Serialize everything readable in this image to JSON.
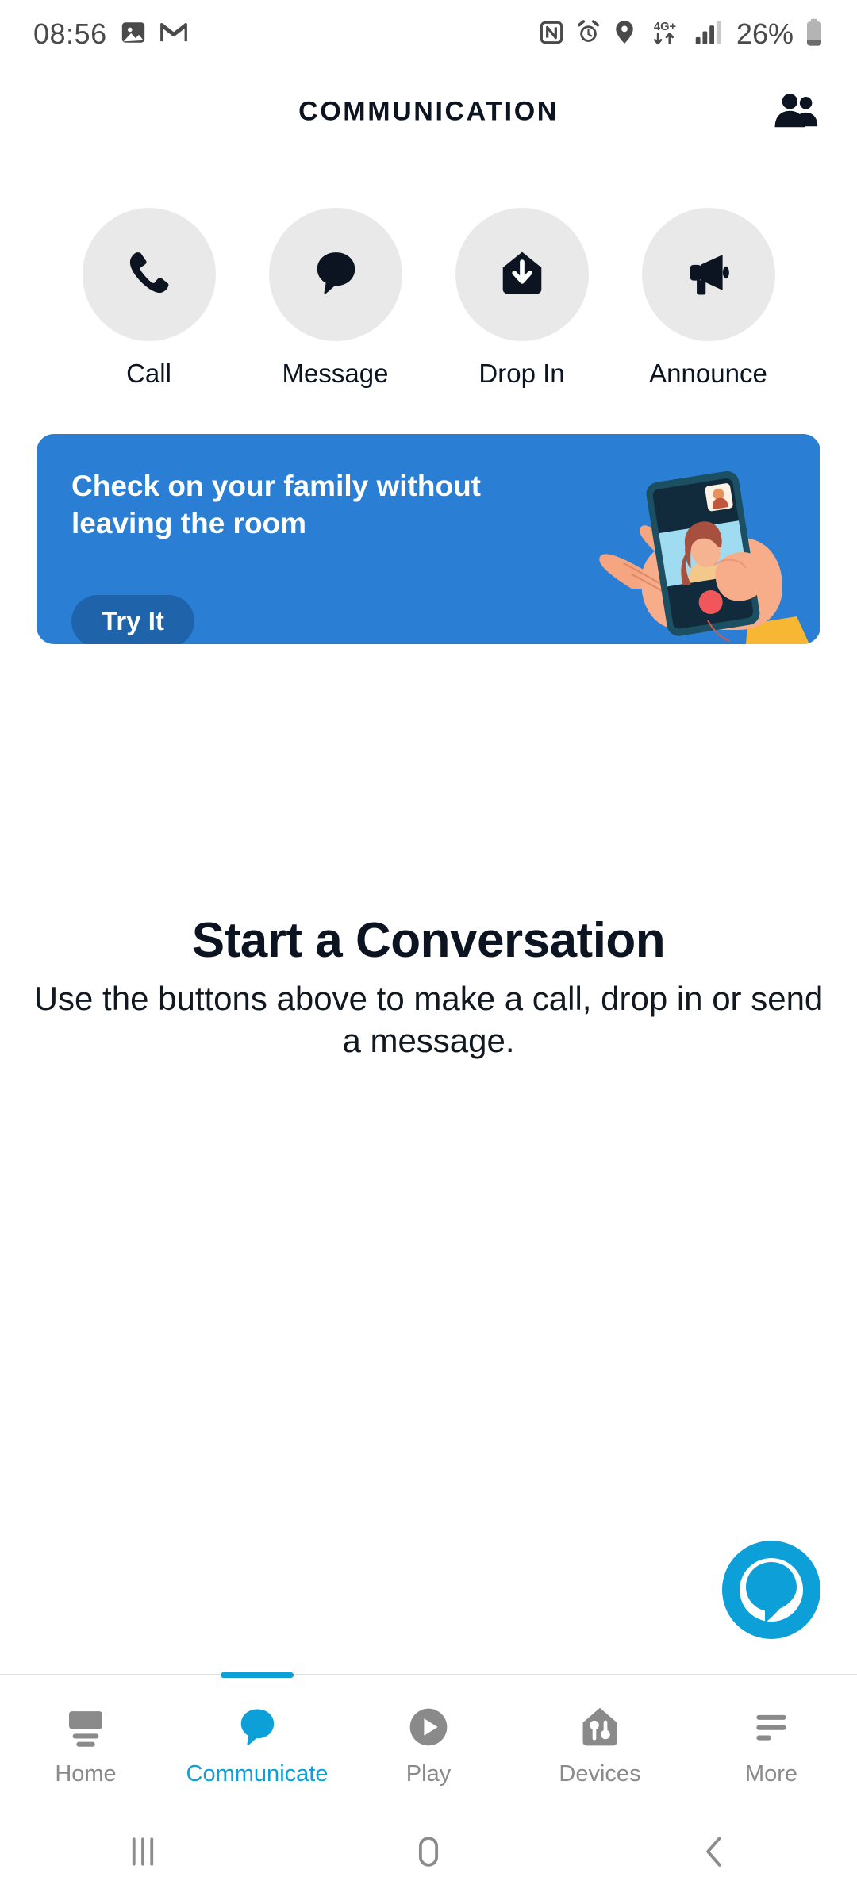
{
  "status_bar": {
    "time": "08:56",
    "battery_percent": "26%",
    "network_type": "4G+",
    "left_icons": [
      "photos-icon",
      "gmail-icon"
    ],
    "right_icons": [
      "nfc-icon",
      "alarm-icon",
      "location-icon",
      "mobile-data-icon",
      "signal-icon",
      "battery-icon"
    ]
  },
  "header": {
    "title": "COMMUNICATION",
    "action_icon": "contacts-icon"
  },
  "quick_actions": [
    {
      "label": "Call",
      "icon": "phone-icon"
    },
    {
      "label": "Message",
      "icon": "speech-bubble-icon"
    },
    {
      "label": "Drop In",
      "icon": "drop-in-house-icon"
    },
    {
      "label": "Announce",
      "icon": "megaphone-icon"
    }
  ],
  "promo_card": {
    "title": "Check on your family without leaving the room",
    "button_label": "Try It",
    "illustration": "hand-holding-phone-video-call-illustration",
    "background_color": "#2a7fd4",
    "button_color": "#1f64ab"
  },
  "empty_state": {
    "title": "Start a Conversation",
    "subtitle": "Use the buttons above to make a call, drop in or send a message."
  },
  "assistant_button": {
    "icon": "alexa-icon",
    "color": "#0d9fd8"
  },
  "bottom_nav": {
    "active_color": "#0d9fd8",
    "inactive_color": "#8a8a8a",
    "items": [
      {
        "label": "Home",
        "icon": "echo-device-icon",
        "active": false
      },
      {
        "label": "Communicate",
        "icon": "speech-bubble-icon",
        "active": true
      },
      {
        "label": "Play",
        "icon": "play-circle-icon",
        "active": false
      },
      {
        "label": "Devices",
        "icon": "devices-house-icon",
        "active": false
      },
      {
        "label": "More",
        "icon": "more-lines-icon",
        "active": false
      }
    ]
  },
  "system_nav": {
    "recents_label": "recents-icon",
    "home_label": "home-icon",
    "back_label": "back-icon"
  }
}
